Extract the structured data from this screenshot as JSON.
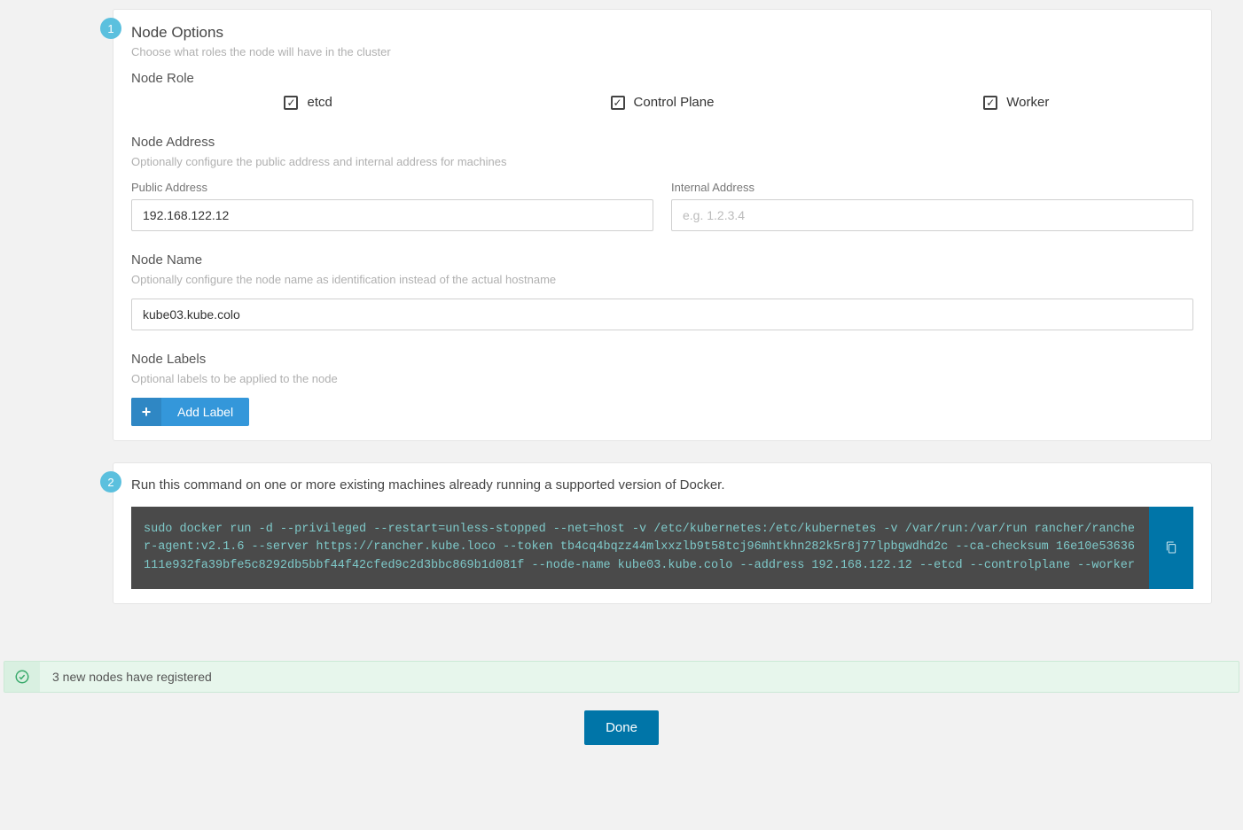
{
  "step1": {
    "number": "1",
    "title": "Node Options",
    "desc": "Choose what roles the node will have in the cluster",
    "role": {
      "title": "Node Role",
      "options": [
        {
          "label": "etcd",
          "checked": true
        },
        {
          "label": "Control Plane",
          "checked": true
        },
        {
          "label": "Worker",
          "checked": true
        }
      ]
    },
    "address": {
      "title": "Node Address",
      "desc": "Optionally configure the public address and internal address for machines",
      "public_label": "Public Address",
      "public_value": "192.168.122.12",
      "internal_label": "Internal Address",
      "internal_placeholder": "e.g. 1.2.3.4"
    },
    "name": {
      "title": "Node Name",
      "desc": "Optionally configure the node name as identification instead of the actual hostname",
      "value": "kube03.kube.colo"
    },
    "labels": {
      "title": "Node Labels",
      "desc": "Optional labels to be applied to the node",
      "add_button": "Add Label"
    }
  },
  "step2": {
    "number": "2",
    "instruction": "Run this command on one or more existing machines already running a supported version of Docker.",
    "command": "sudo docker run -d --privileged --restart=unless-stopped --net=host -v /etc/kubernetes:/etc/kubernetes -v /var/run:/var/run rancher/rancher-agent:v2.1.6 --server https://rancher.kube.loco --token tb4cq4bqzz44mlxxzlb9t58tcj96mhtkhn282k5r8j77lpbgwdhd2c --ca-checksum 16e10e53636111e932fa39bfe5c8292db5bbf44f42cfed9c2d3bbc869b1d081f --node-name kube03.kube.colo --address 192.168.122.12 --etcd --controlplane --worker"
  },
  "notification": {
    "message": "3 new nodes have registered"
  },
  "done_button": "Done"
}
